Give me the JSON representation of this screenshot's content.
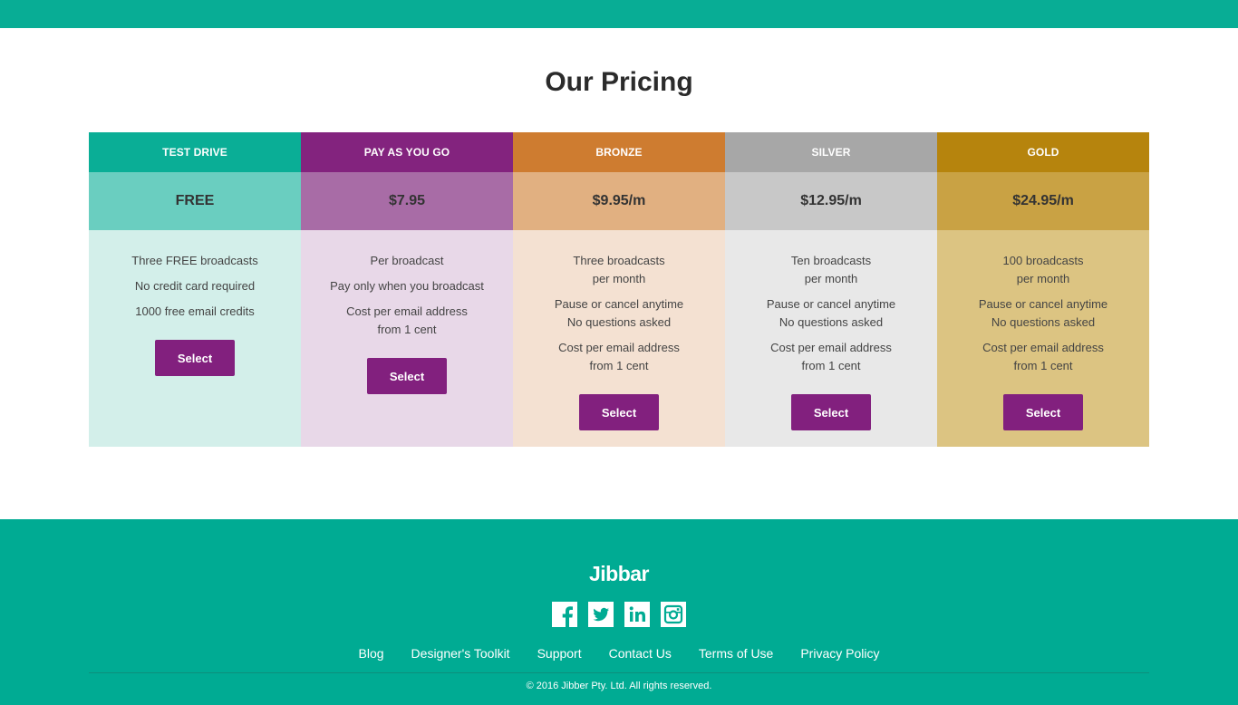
{
  "page_title": "Our Pricing",
  "plans": [
    {
      "name": "TEST DRIVE",
      "price": "FREE",
      "features": [
        [
          "Three FREE broadcasts"
        ],
        [
          "No credit card required"
        ],
        [
          "1000 free email credits"
        ]
      ],
      "button": "Select",
      "colors": {
        "head": "#0aae96",
        "price": "#6acec0",
        "body": "#d3efea"
      }
    },
    {
      "name": "PAY AS YOU GO",
      "price": "$7.95",
      "features": [
        [
          "Per broadcast"
        ],
        [
          "Pay only when you broadcast"
        ],
        [
          "Cost per email address",
          "from 1 cent"
        ]
      ],
      "button": "Select",
      "colors": {
        "head": "#83237e",
        "price": "#a86ca6",
        "body": "#e8d8e8"
      }
    },
    {
      "name": "BRONZE",
      "price": "$9.95/m",
      "features": [
        [
          "Three broadcasts",
          "per month"
        ],
        [
          "Pause or cancel anytime",
          "No questions asked"
        ],
        [
          "Cost per email address",
          "from 1 cent"
        ]
      ],
      "button": "Select",
      "colors": {
        "head": "#ce7c30",
        "price": "#e1b081",
        "body": "#f4e1d2"
      }
    },
    {
      "name": "SILVER",
      "price": "$12.95/m",
      "features": [
        [
          "Ten broadcasts",
          "per month"
        ],
        [
          "Pause or cancel anytime",
          "No questions asked"
        ],
        [
          "Cost per email address",
          "from 1 cent"
        ]
      ],
      "button": "Select",
      "colors": {
        "head": "#a7a7a7",
        "price": "#c8c8c8",
        "body": "#e8e8e8"
      }
    },
    {
      "name": "GOLD",
      "price": "$24.95/m",
      "features": [
        [
          "100 broadcasts",
          "per month"
        ],
        [
          "Pause or cancel anytime",
          "No questions asked"
        ],
        [
          "Cost per email address",
          "from 1 cent"
        ]
      ],
      "button": "Select",
      "colors": {
        "head": "#b6840d",
        "price": "#c9a244",
        "body": "#dcc482"
      }
    }
  ],
  "footer": {
    "logo": "Jibbar",
    "social": [
      "facebook-icon",
      "twitter-icon",
      "linkedin-icon",
      "instagram-icon"
    ],
    "links": [
      "Blog",
      "Designer's Toolkit",
      "Support",
      "Contact Us",
      "Terms of Use",
      "Privacy Policy"
    ],
    "copyright": "© 2016 Jibber Pty. Ltd. All rights reserved."
  },
  "colors": {
    "brand": "#08ad95",
    "footer": "#00ab93",
    "button": "#82207e"
  }
}
